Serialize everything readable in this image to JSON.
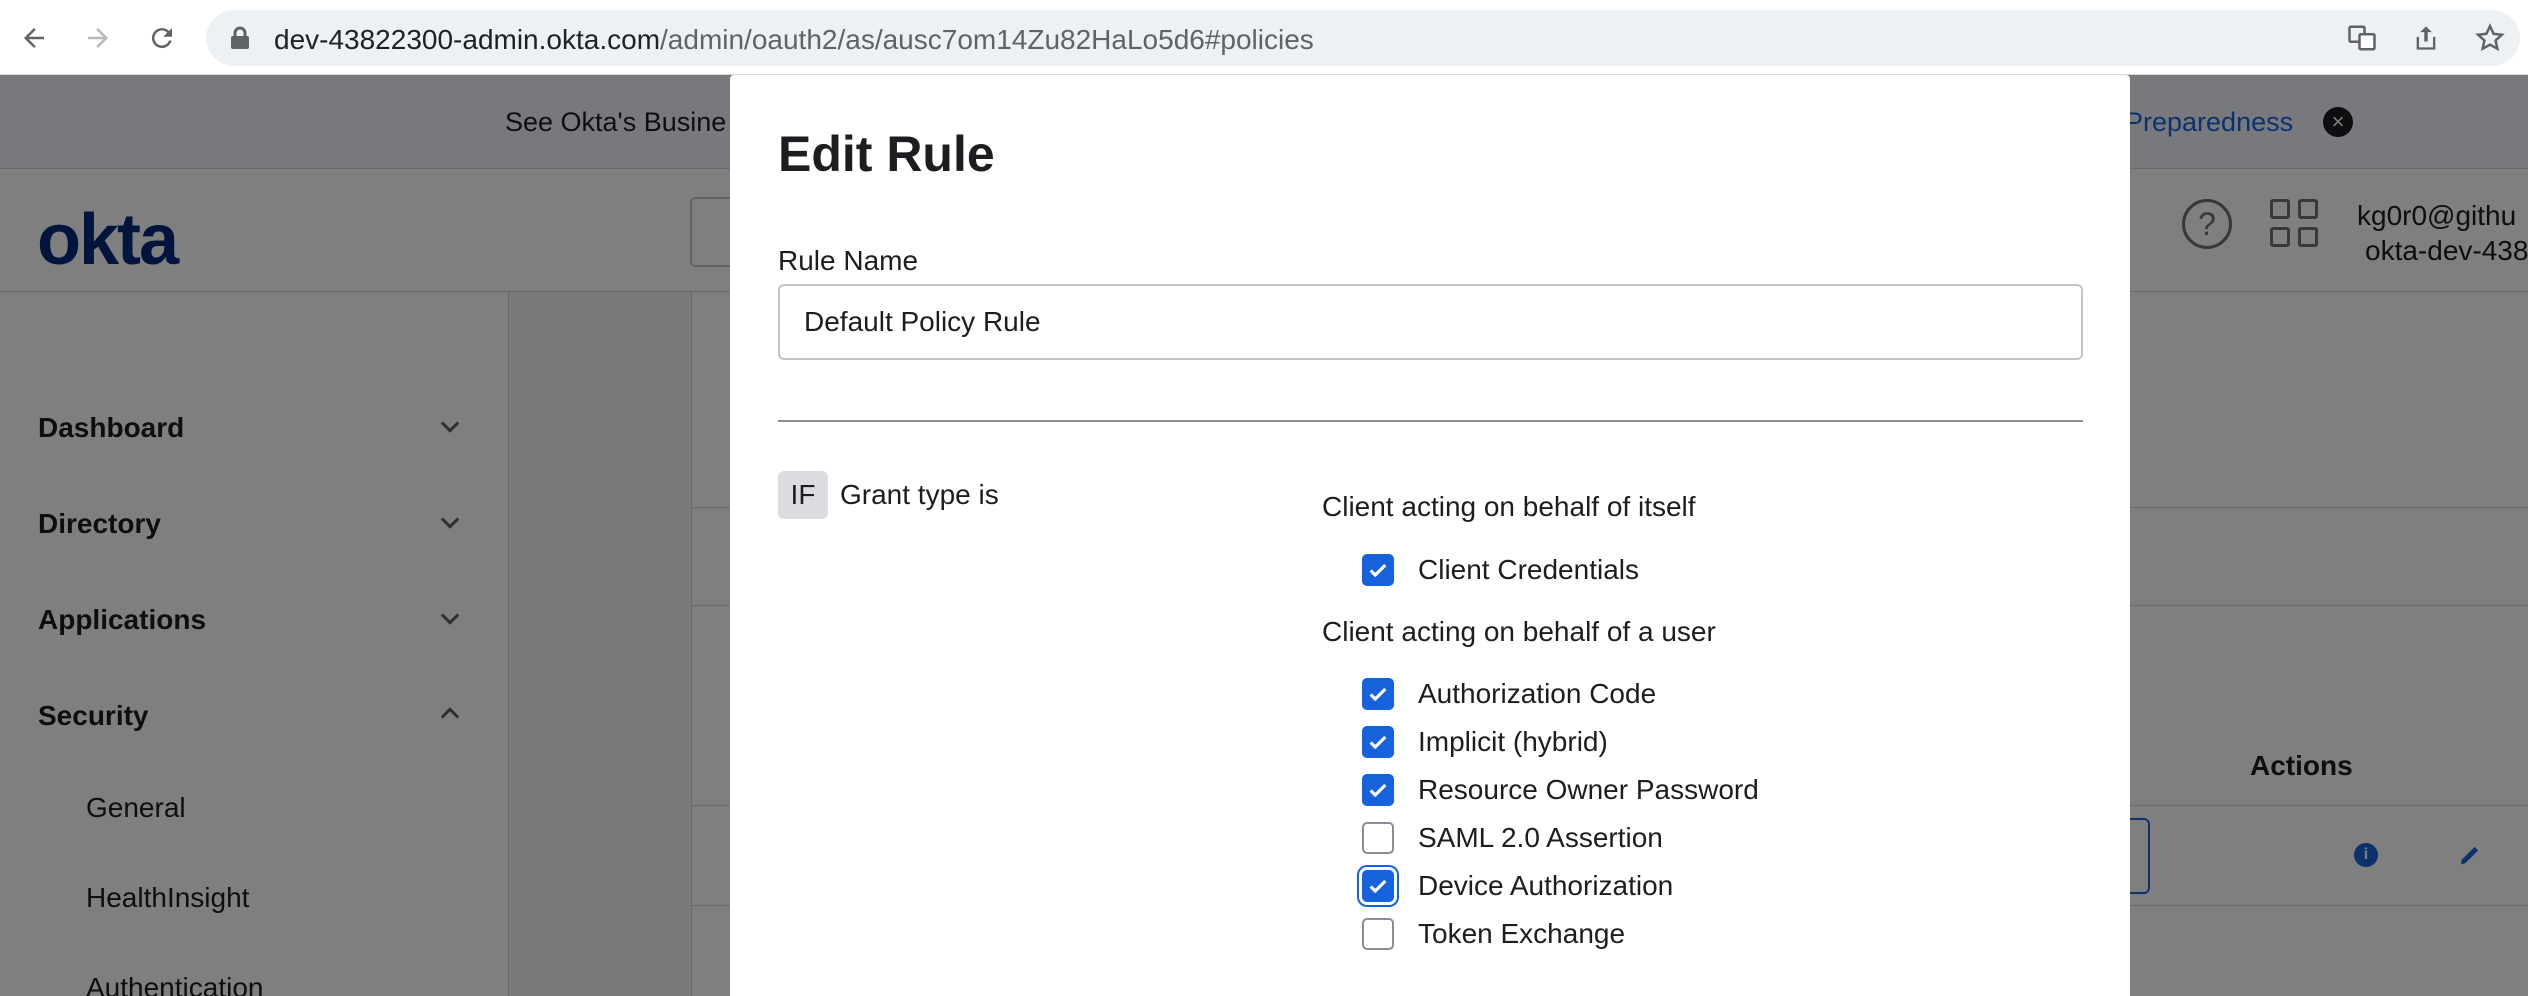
{
  "browser": {
    "url_host": "dev-43822300-admin.okta.com",
    "url_path": "/admin/oauth2/as/ausc7om14Zu82HaLo5d6#policies"
  },
  "banner": {
    "text": "See Okta's Busine",
    "link": "Preparedness"
  },
  "header": {
    "logo": "okta",
    "user_email": "kg0r0@githu",
    "org": "okta-dev-438"
  },
  "sidebar": {
    "items": [
      {
        "label": "Dashboard"
      },
      {
        "label": "Directory"
      },
      {
        "label": "Applications"
      },
      {
        "label": "Security"
      }
    ],
    "sub_items": [
      {
        "label": "General"
      },
      {
        "label": "HealthInsight"
      },
      {
        "label": "Authentication"
      }
    ]
  },
  "table": {
    "actions_header": "Actions"
  },
  "modal": {
    "title": "Edit Rule",
    "rule_name_label": "Rule Name",
    "rule_name_value": "Default Policy Rule",
    "if_badge": "IF",
    "if_text": "Grant type is",
    "group_self": "Client acting on behalf of itself",
    "group_user": "Client acting on behalf of a user",
    "grants_self": [
      {
        "label": "Client Credentials",
        "checked": true
      }
    ],
    "grants_user": [
      {
        "label": "Authorization Code",
        "checked": true
      },
      {
        "label": "Implicit (hybrid)",
        "checked": true
      },
      {
        "label": "Resource Owner Password",
        "checked": true
      },
      {
        "label": "SAML 2.0 Assertion",
        "checked": false
      },
      {
        "label": "Device Authorization",
        "checked": true
      },
      {
        "label": "Token Exchange",
        "checked": false
      }
    ]
  },
  "colors": {
    "accent": "#1662dd",
    "overlay": "#000000"
  }
}
